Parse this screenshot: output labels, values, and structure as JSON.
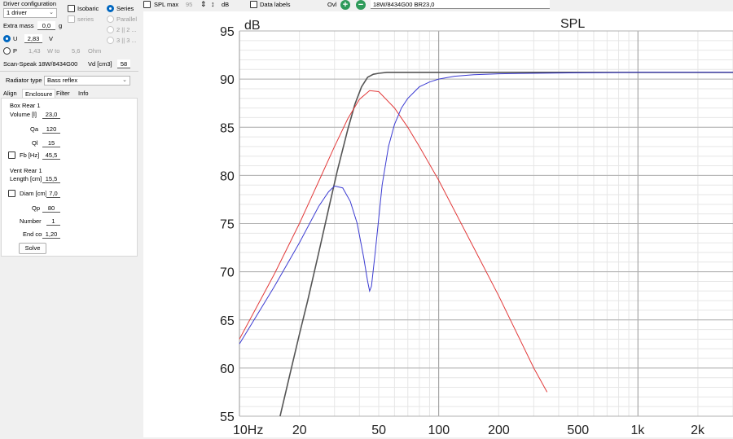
{
  "driver_config": {
    "title": "Driver configuration",
    "count_value": "1 driver",
    "isobaric_label": "Isobaric",
    "series_label": "Series",
    "series_dis_label": "series",
    "parallel_label": "Parallel",
    "opt_2x2": "2 || 2 ...",
    "opt_3x3": "3 || 3 ...",
    "extra_mass_label": "Extra mass",
    "extra_mass_value": "0,0",
    "extra_mass_unit": "g",
    "u_label": "U",
    "u_value": "2,83",
    "u_unit": "V",
    "p_label": "P",
    "p_value": "1,43",
    "p_unit": "W to",
    "ohm_value": "5,6",
    "ohm_unit": "Ohm",
    "driver_name": "Scan-Speak 18W/8434G00",
    "vd_label": "Vd [cm3]",
    "vd_value": "58"
  },
  "radiator": {
    "label": "Radiator type",
    "value": "Bass reflex"
  },
  "tabs": [
    "Align",
    "Enclosure",
    "Filter",
    "Info"
  ],
  "box_rear": {
    "title": "Box Rear 1",
    "volume_label": "Volume [l]",
    "volume_value": "23,0",
    "qa_label": "Qa",
    "qa_value": "120",
    "ql_label": "Ql",
    "ql_value": "15",
    "fb_label": "Fb [Hz]",
    "fb_value": "45,5"
  },
  "vent_rear": {
    "title": "Vent Rear 1",
    "length_label": "Length [cm]",
    "length_value": "15,5",
    "diam_label": "Diam [cm]",
    "diam_value": "7,0",
    "qp_label": "Qp",
    "qp_value": "80",
    "number_label": "Number",
    "number_value": "1",
    "endcorr_label": "End corr",
    "endcorr_value": "1,20",
    "solve_label": "Solve"
  },
  "toolbar": {
    "splmax_label": "SPL max",
    "splmax_value": "95",
    "db_label": "dB",
    "datalabels_label": "Data labels",
    "ovl_label": "Ovl",
    "plus_glyph": "+",
    "minus_glyph": "−",
    "overlay_name": "18W/8434G00 BR23,0"
  },
  "colors": {
    "accent": "#0067c0",
    "add_green": "#2e9a5a",
    "curve_black": "#555555",
    "curve_red": "#e23a3a",
    "curve_blue": "#3c3cd2"
  },
  "chart_data": {
    "type": "line",
    "title": "SPL",
    "ylabel": "dB",
    "xscale": "log",
    "xlim": [
      10,
      3000
    ],
    "ylim": [
      55,
      95
    ],
    "xticks": [
      10,
      20,
      50,
      100,
      200,
      500,
      1000,
      2000
    ],
    "xtick_labels": [
      "10Hz",
      "20",
      "50",
      "100",
      "200",
      "500",
      "1k",
      "2k"
    ],
    "yticks": [
      55,
      60,
      65,
      70,
      75,
      80,
      85,
      90,
      95
    ],
    "ytick_labels": [
      "55",
      "60",
      "65",
      "70",
      "75",
      "80",
      "85",
      "90",
      "95"
    ],
    "grid": true,
    "series": [
      {
        "color": "#555555",
        "x": [
          16,
          18,
          20,
          22,
          25,
          28,
          31,
          35,
          38,
          41,
          44,
          47,
          50,
          55,
          60,
          70,
          80,
          100,
          200,
          500,
          1000,
          3000
        ],
        "y": [
          55,
          59.5,
          63.5,
          67,
          72,
          76.5,
          80.5,
          84.8,
          87.4,
          89.2,
          90.2,
          90.5,
          90.6,
          90.7,
          90.7,
          90.7,
          90.7,
          90.7,
          90.7,
          90.7,
          90.7,
          90.7
        ]
      },
      {
        "color": "#e23a3a",
        "x": [
          10,
          15,
          20,
          25,
          30,
          35,
          40,
          45,
          50,
          60,
          70,
          80,
          100,
          150,
          200,
          300,
          350
        ],
        "y": [
          63,
          69.8,
          75,
          79.4,
          83,
          85.9,
          87.9,
          88.8,
          88.7,
          87,
          85,
          83,
          79.5,
          72.5,
          67.5,
          60,
          57.5
        ]
      },
      {
        "color": "#3c3cd2",
        "x": [
          10,
          15,
          20,
          25,
          28,
          30,
          33,
          36,
          39,
          42,
          44,
          45,
          46,
          48,
          52,
          56,
          60,
          65,
          70,
          80,
          90,
          100,
          120,
          150,
          200,
          300,
          500,
          1000,
          3000
        ],
        "y": [
          62.5,
          68.5,
          73,
          76.8,
          78.3,
          78.9,
          78.7,
          77.3,
          75,
          71.5,
          69,
          68,
          68.5,
          72,
          79,
          83,
          85.3,
          87,
          88,
          89.2,
          89.7,
          90,
          90.3,
          90.45,
          90.55,
          90.6,
          90.65,
          90.7,
          90.7
        ]
      }
    ]
  }
}
